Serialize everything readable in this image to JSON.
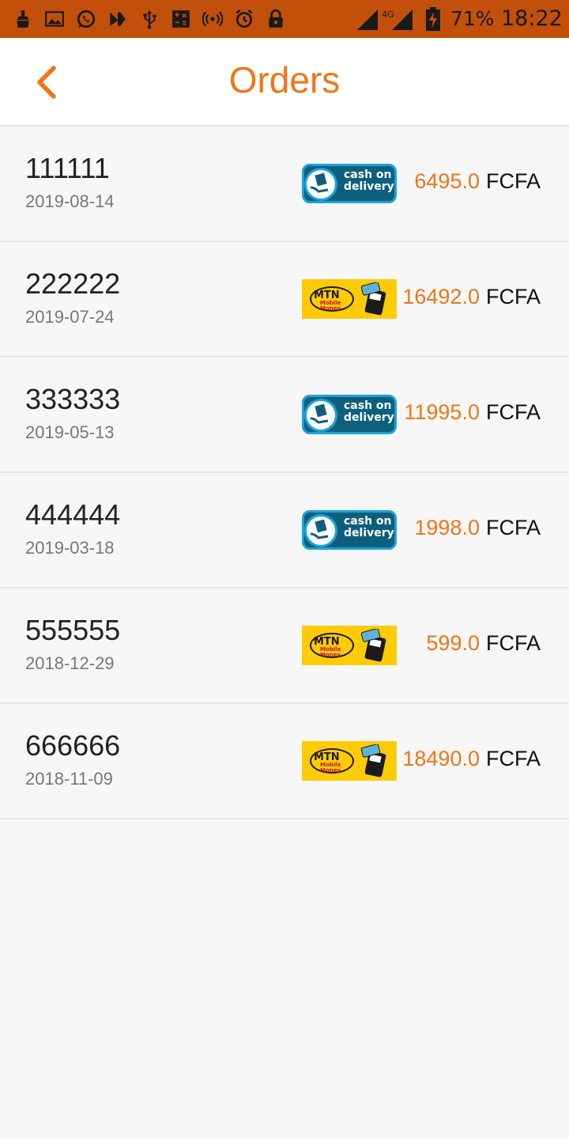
{
  "status_bar": {
    "battery_percent": "71%",
    "time": "18:22",
    "network": "4G",
    "icons": [
      "cleaner-icon",
      "gallery-icon",
      "whatsapp-icon",
      "n-icon",
      "usb-icon",
      "calculator-icon",
      "hotspot-icon",
      "alarm-icon",
      "lock-icon",
      "signal-icon",
      "battery-charging-icon"
    ]
  },
  "header": {
    "title": "Orders",
    "back_icon": "chevron-left-icon"
  },
  "colors": {
    "accent": "#f47415",
    "status_bar": "#c2500a",
    "cod_badge": "#0e5f7d",
    "mtn_badge": "#ffcb05"
  },
  "payment_badges": {
    "cod": {
      "line1": "cash on",
      "line2": "delivery"
    },
    "mtn": {
      "brand": "MTN",
      "line1": "Mobile",
      "line2": "Money"
    }
  },
  "orders": [
    {
      "id": "111111",
      "date": "2019-08-14",
      "payment": "cod",
      "amount": "6495.0",
      "currency": "FCFA"
    },
    {
      "id": "222222",
      "date": "2019-07-24",
      "payment": "mtn",
      "amount": "16492.0",
      "currency": "FCFA"
    },
    {
      "id": "333333",
      "date": "2019-05-13",
      "payment": "cod",
      "amount": "11995.0",
      "currency": "FCFA"
    },
    {
      "id": "444444",
      "date": "2019-03-18",
      "payment": "cod",
      "amount": "1998.0",
      "currency": "FCFA"
    },
    {
      "id": "555555",
      "date": "2018-12-29",
      "payment": "mtn",
      "amount": "599.0",
      "currency": "FCFA"
    },
    {
      "id": "666666",
      "date": "2018-11-09",
      "payment": "mtn",
      "amount": "18490.0",
      "currency": "FCFA"
    }
  ]
}
